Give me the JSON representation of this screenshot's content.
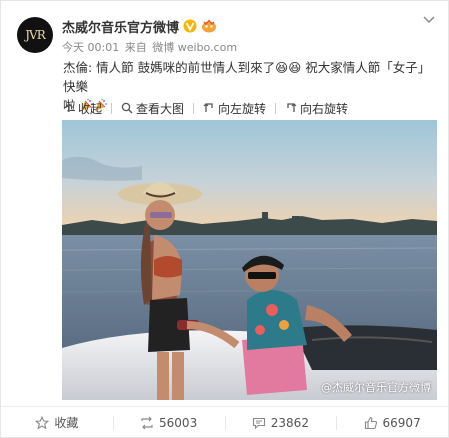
{
  "post": {
    "username": "杰威尔音乐官方微博",
    "avatar_text": "JVR",
    "time": "今天 00:01",
    "source_prefix": "来自",
    "source": "微博 weibo.com",
    "text_line1": "杰倫: 情人節 鼓媽咪的前世情人到來了😆😆 祝大家情人節「女子」快樂",
    "text_line2": "啦",
    "watermark": "@杰威尔音乐官方微博"
  },
  "toolbar": {
    "collapse": "收起",
    "view_large": "查看大图",
    "rotate_left": "向左旋转",
    "rotate_right": "向右旋转"
  },
  "actions": {
    "favorite": "收藏",
    "repost_count": "56003",
    "comment_count": "23862",
    "like_count": "66907"
  },
  "colors": {
    "username": "#333333",
    "meta": "#888888",
    "verified": "#f6b500",
    "accent_link": "#eb7350"
  }
}
